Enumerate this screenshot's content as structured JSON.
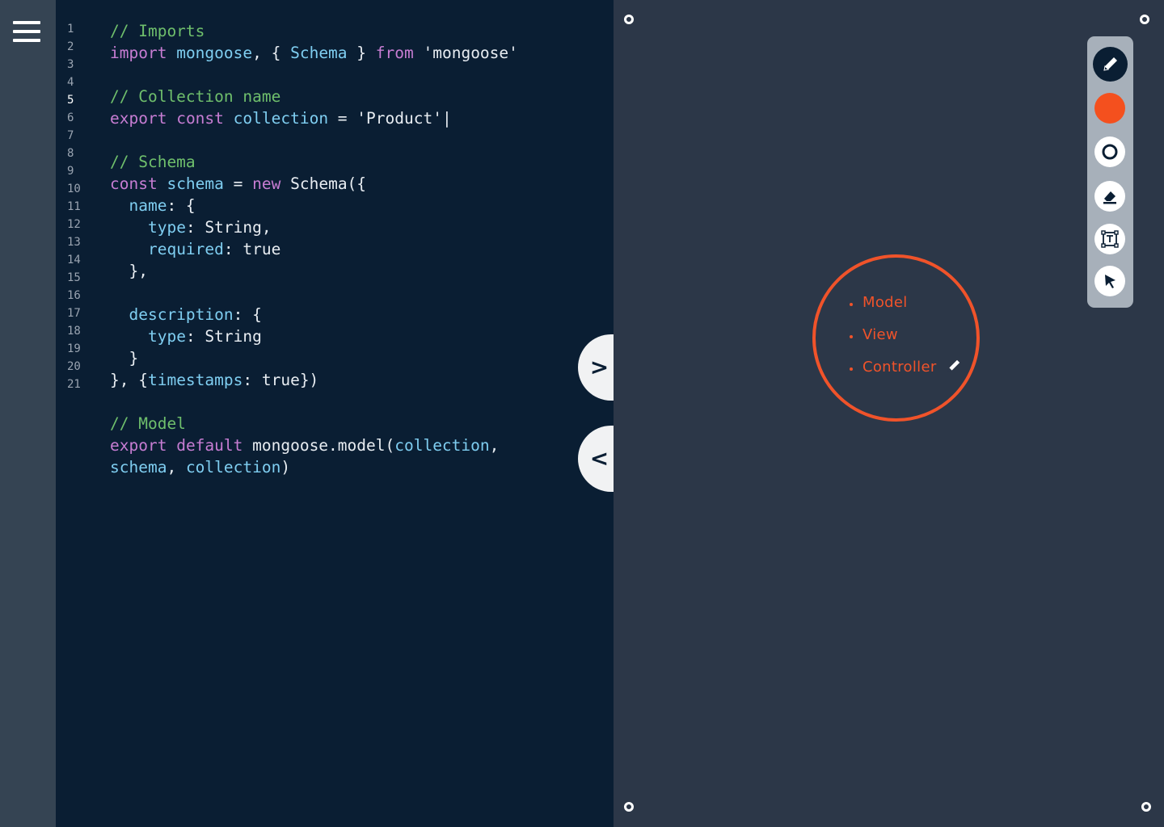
{
  "menu": {
    "icon": "hamburger-menu-icon"
  },
  "editor": {
    "active_line": 5,
    "line_numbers": [
      "1",
      "2",
      "3",
      "4",
      "5",
      "6",
      "7",
      "8",
      "9",
      "10",
      "11",
      "12",
      "13",
      "14",
      "15",
      "16",
      "17",
      "18",
      "19",
      "20",
      "21"
    ]
  },
  "code_lines": [
    [
      {
        "t": "// Imports",
        "c": "cm"
      }
    ],
    [
      {
        "t": "import",
        "c": "kw"
      },
      {
        "t": " ",
        "c": "pl"
      },
      {
        "t": "mongoose",
        "c": "id"
      },
      {
        "t": ", { ",
        "c": "pl"
      },
      {
        "t": "Schema",
        "c": "id"
      },
      {
        "t": " } ",
        "c": "pl"
      },
      {
        "t": "from",
        "c": "kw"
      },
      {
        "t": " 'mongoose'",
        "c": "str"
      }
    ],
    [],
    [
      {
        "t": "// Collection name",
        "c": "cm"
      }
    ],
    [
      {
        "t": "export",
        "c": "kw"
      },
      {
        "t": " ",
        "c": "pl"
      },
      {
        "t": "const",
        "c": "kw"
      },
      {
        "t": " ",
        "c": "pl"
      },
      {
        "t": "collection",
        "c": "id"
      },
      {
        "t": " = 'Product'|",
        "c": "pl"
      }
    ],
    [],
    [
      {
        "t": "// Schema",
        "c": "cm"
      }
    ],
    [
      {
        "t": "const",
        "c": "kw"
      },
      {
        "t": " ",
        "c": "pl"
      },
      {
        "t": "schema",
        "c": "id"
      },
      {
        "t": " = ",
        "c": "pl"
      },
      {
        "t": "new",
        "c": "kw"
      },
      {
        "t": " Schema({",
        "c": "pl"
      }
    ],
    [
      {
        "t": "  ",
        "c": "pl"
      },
      {
        "t": "name",
        "c": "id"
      },
      {
        "t": ": {",
        "c": "pl"
      }
    ],
    [
      {
        "t": "    ",
        "c": "pl"
      },
      {
        "t": "type",
        "c": "id"
      },
      {
        "t": ": String,",
        "c": "pl"
      }
    ],
    [
      {
        "t": "    ",
        "c": "pl"
      },
      {
        "t": "required",
        "c": "id"
      },
      {
        "t": ": true",
        "c": "pl"
      }
    ],
    [
      {
        "t": "  },",
        "c": "pl"
      }
    ],
    [],
    [
      {
        "t": "  ",
        "c": "pl"
      },
      {
        "t": "description",
        "c": "id"
      },
      {
        "t": ": {",
        "c": "pl"
      }
    ],
    [
      {
        "t": "    ",
        "c": "pl"
      },
      {
        "t": "type",
        "c": "id"
      },
      {
        "t": ": String",
        "c": "pl"
      }
    ],
    [
      {
        "t": "  }",
        "c": "pl"
      }
    ],
    [
      {
        "t": "}, {",
        "c": "pl"
      },
      {
        "t": "timestamps",
        "c": "id"
      },
      {
        "t": ": true})",
        "c": "pl"
      }
    ],
    [],
    [
      {
        "t": "// Model",
        "c": "cm"
      }
    ],
    [
      {
        "t": "export",
        "c": "kw"
      },
      {
        "t": " ",
        "c": "pl"
      },
      {
        "t": "default",
        "c": "kw"
      },
      {
        "t": " mongoose.model(",
        "c": "pl"
      },
      {
        "t": "collection",
        "c": "id"
      },
      {
        "t": ",",
        "c": "pl"
      }
    ],
    [
      {
        "t": "schema",
        "c": "id"
      },
      {
        "t": ", ",
        "c": "pl"
      },
      {
        "t": "collection",
        "c": "id"
      },
      {
        "t": ")",
        "c": "pl"
      }
    ]
  ],
  "toggles": {
    "expand_label": ">",
    "collapse_label": "<"
  },
  "note": {
    "items": [
      "Model",
      "View",
      "Controller"
    ],
    "color": "#f0532a"
  },
  "toolbar": {
    "tools": [
      {
        "name": "pen-tool",
        "icon": "pencil-icon",
        "active": true
      },
      {
        "name": "color-picker",
        "icon": "color-swatch-icon",
        "color": "#f0532a"
      },
      {
        "name": "shape-tool",
        "icon": "circle-outline-icon"
      },
      {
        "name": "eraser-tool",
        "icon": "eraser-icon"
      },
      {
        "name": "text-tool",
        "icon": "text-box-icon"
      },
      {
        "name": "select-tool",
        "icon": "cursor-arrow-icon"
      }
    ]
  },
  "colors": {
    "editor_bg": "#0a1e33",
    "canvas_bg": "#2c3748",
    "rail_bg": "#354453",
    "accent": "#f0532a"
  }
}
